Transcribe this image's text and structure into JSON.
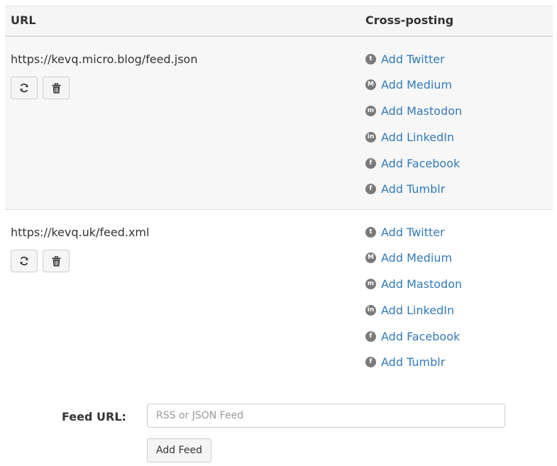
{
  "table": {
    "header": {
      "url_label": "URL",
      "cross_label": "Cross-posting"
    },
    "feeds": [
      {
        "url": "https://kevq.micro.blog/feed.json",
        "links": [
          {
            "label": "Add Twitter",
            "icon": "twitter-icon",
            "glyph": "t"
          },
          {
            "label": "Add Medium",
            "icon": "medium-icon",
            "glyph": "M"
          },
          {
            "label": "Add Mastodon",
            "icon": "mastodon-icon",
            "glyph": "m"
          },
          {
            "label": "Add LinkedIn",
            "icon": "linkedin-icon",
            "glyph": "in"
          },
          {
            "label": "Add Facebook",
            "icon": "facebook-icon",
            "glyph": "f"
          },
          {
            "label": "Add Tumblr",
            "icon": "tumblr-icon",
            "glyph": "f"
          }
        ]
      },
      {
        "url": "https://kevq.uk/feed.xml",
        "links": [
          {
            "label": "Add Twitter",
            "icon": "twitter-icon",
            "glyph": "t"
          },
          {
            "label": "Add Medium",
            "icon": "medium-icon",
            "glyph": "M"
          },
          {
            "label": "Add Mastodon",
            "icon": "mastodon-icon",
            "glyph": "m"
          },
          {
            "label": "Add LinkedIn",
            "icon": "linkedin-icon",
            "glyph": "in"
          },
          {
            "label": "Add Facebook",
            "icon": "facebook-icon",
            "glyph": "f"
          },
          {
            "label": "Add Tumblr",
            "icon": "tumblr-icon",
            "glyph": "f"
          }
        ]
      }
    ]
  },
  "form": {
    "label": "Feed URL:",
    "placeholder": "RSS or JSON Feed",
    "value": "",
    "submit_label": "Add Feed"
  },
  "colors": {
    "link": "#337ab7",
    "header_bg": "#f5f5f5",
    "stripe_bg": "#f7f7f7",
    "icon_bg": "#7a7a7a"
  }
}
